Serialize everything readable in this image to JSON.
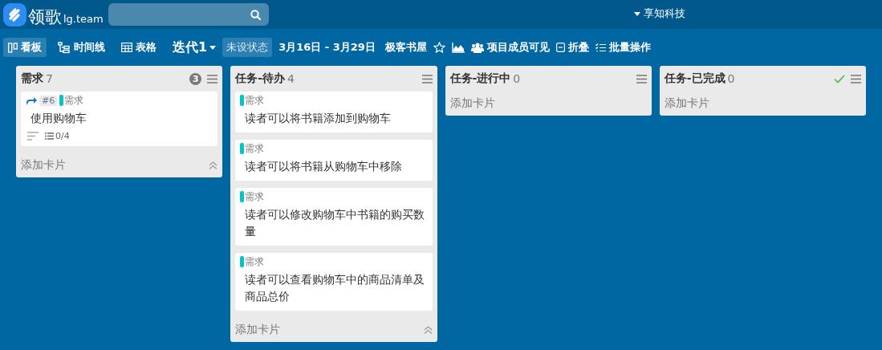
{
  "header": {
    "logo_text": "领歌",
    "logo_suffix": "lg.team",
    "org": "享知科技"
  },
  "toolbar": {
    "views": [
      {
        "label": "看板",
        "kind": "board",
        "selected": true
      },
      {
        "label": "时间线",
        "kind": "timeline",
        "selected": false
      },
      {
        "label": "表格",
        "kind": "table",
        "selected": false
      }
    ],
    "iteration": "迭代1",
    "status": "未设状态",
    "date_range": "3月16日 - 3月29日",
    "project": "极客书屋",
    "visibility": "项目成员可见",
    "collapse": "折叠",
    "batch": "批量操作"
  },
  "lists": [
    {
      "title": "需求",
      "count": "7",
      "badge": "3",
      "done": false,
      "collapsible": true,
      "add_label": "添加卡片",
      "cards": [
        {
          "linked": true,
          "number": "#6",
          "label": {
            "text": "需求",
            "color": "#00c4c8"
          },
          "title": "使用购物车",
          "has_description": true,
          "checklist": "0/4"
        }
      ]
    },
    {
      "title": "任务-待办",
      "count": "4",
      "done": false,
      "collapsible": true,
      "add_label": "添加卡片",
      "cards": [
        {
          "linked": false,
          "label": {
            "text": "需求",
            "color": "#00c4c8"
          },
          "title": "读者可以将书籍添加到购物车",
          "has_description": false
        },
        {
          "linked": false,
          "label": {
            "text": "需求",
            "color": "#00c4c8"
          },
          "title": "读者可以将书籍从购物车中移除",
          "has_description": false
        },
        {
          "linked": false,
          "label": {
            "text": "需求",
            "color": "#00c4c8"
          },
          "title": "读者可以修改购物车中书籍的购买数量",
          "has_description": false
        },
        {
          "linked": false,
          "label": {
            "text": "需求",
            "color": "#00c4c8"
          },
          "title": "读者可以查看购物车中的商品清单及商品总价",
          "has_description": false
        }
      ]
    },
    {
      "title": "任务-进行中",
      "count": "0",
      "done": false,
      "collapsible": false,
      "add_label": "添加卡片"
    },
    {
      "title": "任务-已完成",
      "count": "0",
      "done": true,
      "collapsible": false,
      "add_label": "添加卡片"
    }
  ]
}
